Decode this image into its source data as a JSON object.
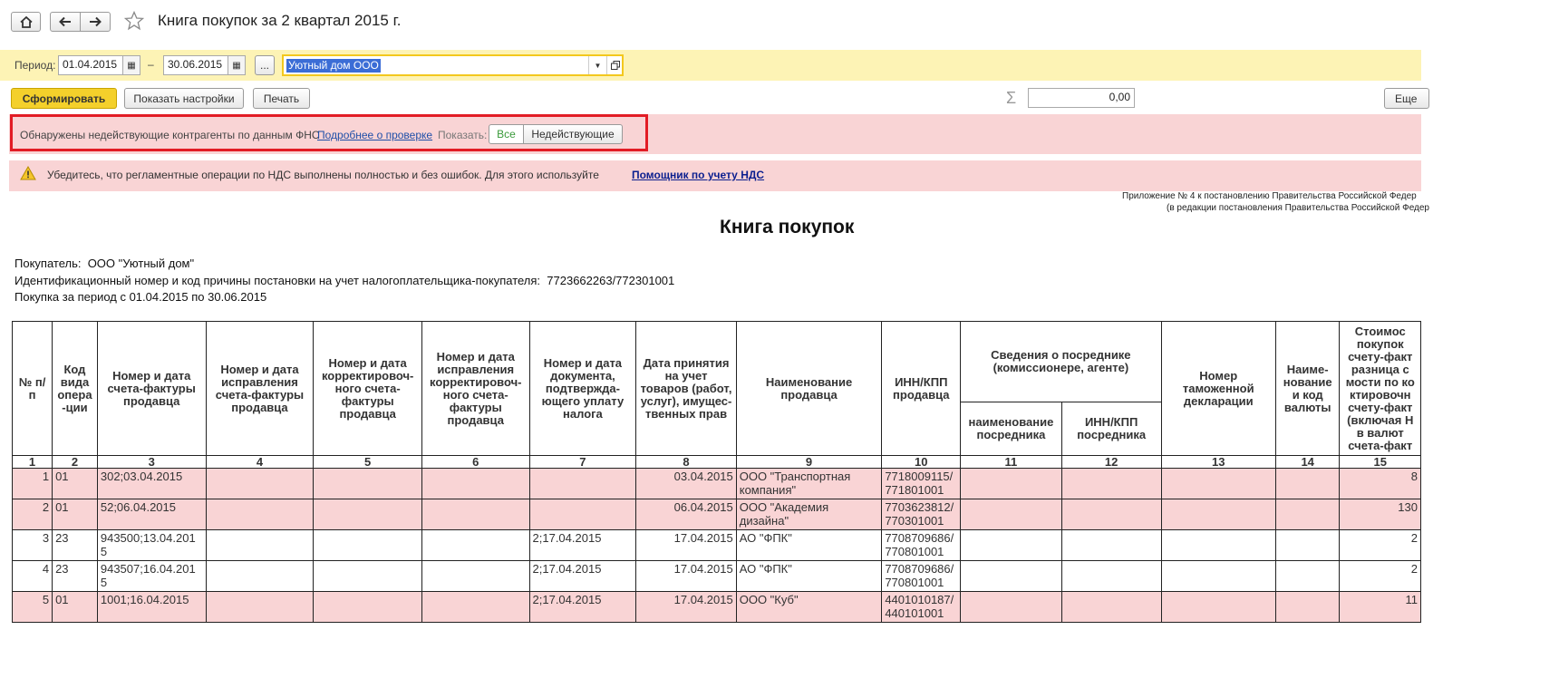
{
  "window": {
    "title": "Книга покупок за 2 квартал 2015 г."
  },
  "filter": {
    "period_label": "Период:",
    "date_from": "01.04.2015",
    "dash": "–",
    "date_to": "30.06.2015",
    "dots_label": "...",
    "organization": "Уютный дом ООО"
  },
  "actions": {
    "generate": "Сформировать",
    "settings": "Показать настройки",
    "print": "Печать",
    "sum_value": "0,00",
    "more": "Еще"
  },
  "warning": {
    "text": "Обнаружены недействующие контрагенты по данным ФНС",
    "link": "Подробнее о проверке",
    "show_label": "Показать:",
    "toggle_all": "Все",
    "toggle_inactive": "Недействующие"
  },
  "notice": {
    "text": "Убедитесь, что регламентные операции по НДС выполнены полностью и без ошибок. Для этого используйте",
    "link": "Помощник по учету НДС"
  },
  "report": {
    "appendix_1": "Приложение № 4 к постановлению Правительства Российской Федер",
    "appendix_2": "(в редакции постановления Правительства Российской Федер",
    "heading": "Книга покупок",
    "buyer": "Покупатель:  ООО \"Уютный дом\"",
    "inn_line": "Идентификационный номер и код причины постановки на учет налогоплательщика-покупателя:  7723662263/772301001",
    "period_line": "Покупка за период с 01.04.2015 по 30.06.2015"
  },
  "table": {
    "headers": {
      "h1": "№ п/п",
      "h2": "Код вида опера -ции",
      "h3": "Номер и дата счета-фактуры продавца",
      "h4": "Номер и дата исправления счета-фактуры продавца",
      "h5": "Номер и дата корректировоч-ного счета-фактуры продавца",
      "h6": "Номер и дата исправления корректировоч-ного счета-фактуры продавца",
      "h7": "Номер и дата документа, подтвержда-ющего уплату налога",
      "h8": "Дата принятия на учет товаров (работ, услуг), имущес-твенных прав",
      "h9": "Наименование продавца",
      "h10": "ИНН/КПП продавца",
      "h11_12": "Сведения о посреднике (комиссионере, агенте)",
      "h11": "наименование посредника",
      "h12": "ИНН/КПП посредника",
      "h13": "Номер таможенной декларации",
      "h14": "Наиме-нование и код валюты",
      "h15": "Стоимос покупок счету-факт разница с мости по ко ктировочн счету-факт (включая Н в валют счета-факт"
    },
    "col_numbers": [
      "1",
      "2",
      "3",
      "4",
      "5",
      "6",
      "7",
      "8",
      "9",
      "10",
      "11",
      "12",
      "13",
      "14",
      "15"
    ],
    "rows": [
      {
        "n": "1",
        "code": "01",
        "invoice": "302;03.04.2015",
        "payment": "",
        "date": "03.04.2015",
        "seller": "ООО \"Транспортная компания\"",
        "inn": "7718009115/ 771801001",
        "amount": "8",
        "pink": true
      },
      {
        "n": "2",
        "code": "01",
        "invoice": "52;06.04.2015",
        "payment": "",
        "date": "06.04.2015",
        "seller": "ООО \"Академия дизайна\"",
        "inn": "7703623812/ 770301001",
        "amount": "130",
        "pink": true
      },
      {
        "n": "3",
        "code": "23",
        "invoice": "943500;13.04.201 5",
        "payment": "2;17.04.2015",
        "date": "17.04.2015",
        "seller": "АО \"ФПК\"",
        "inn": "7708709686/ 770801001",
        "amount": "2",
        "pink": false
      },
      {
        "n": "4",
        "code": "23",
        "invoice": "943507;16.04.201 5",
        "payment": "2;17.04.2015",
        "date": "17.04.2015",
        "seller": "АО \"ФПК\"",
        "inn": "7708709686/ 770801001",
        "amount": "2",
        "pink": false
      },
      {
        "n": "5",
        "code": "01",
        "invoice": "1001;16.04.2015",
        "payment": "2;17.04.2015",
        "date": "17.04.2015",
        "seller": "ООО \"Куб\"",
        "inn": "4401010187/ 440101001",
        "amount": "11",
        "pink": true
      }
    ]
  },
  "colors": {
    "accent_yellow": "#f4d02b",
    "row_pink": "#f9d4d5",
    "frame_red": "#e21c25"
  }
}
